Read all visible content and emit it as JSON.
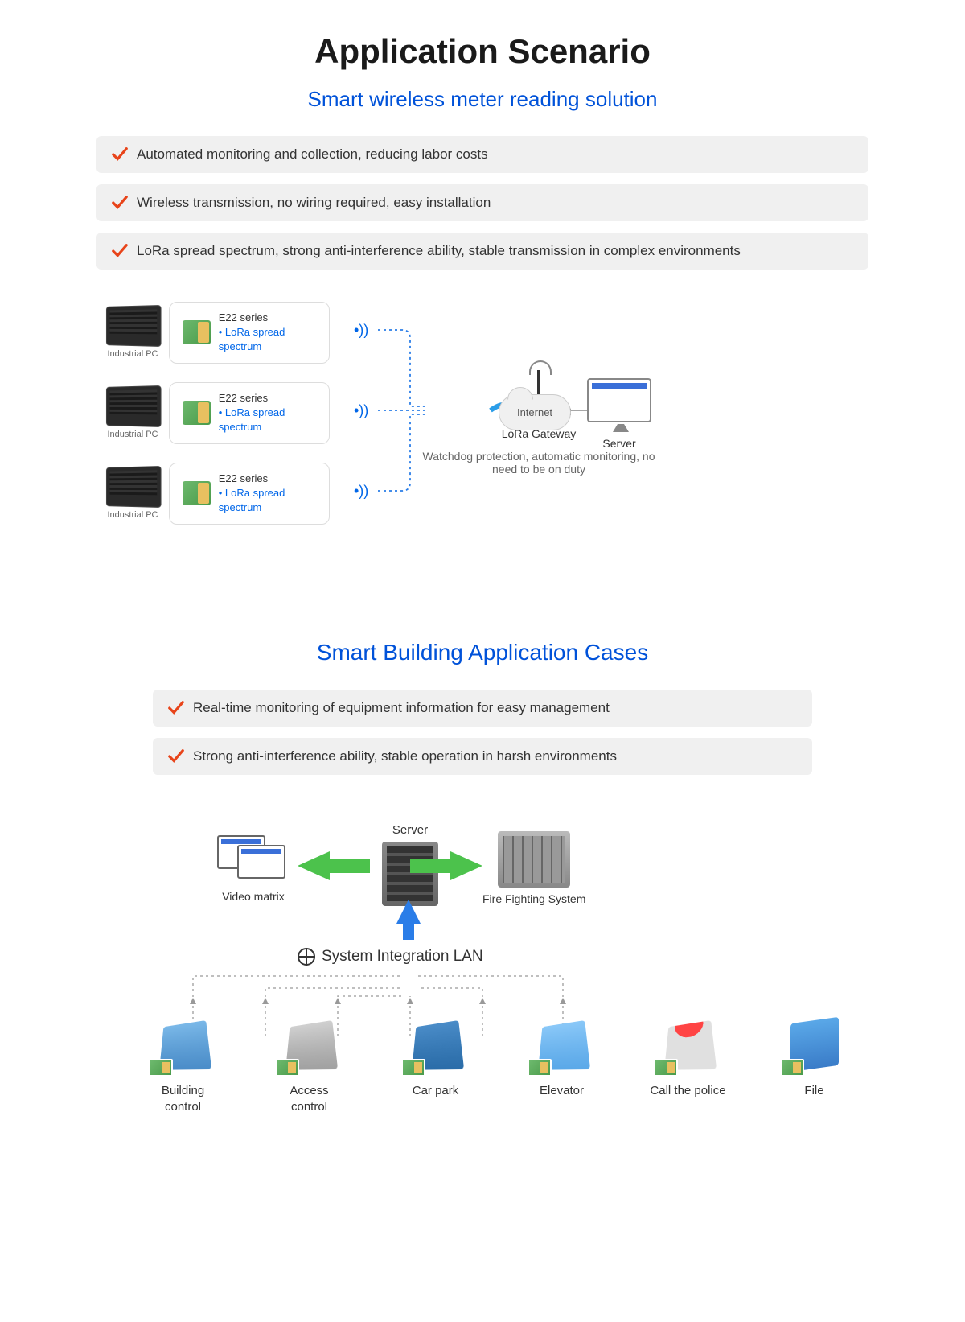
{
  "main": {
    "title": "Application Scenario",
    "subtitle1": "Smart wireless meter reading solution",
    "features1": [
      "Automated monitoring and collection, reducing labor costs",
      "Wireless transmission, no wiring required, easy installation",
      "LoRa spread spectrum, strong anti-interference ability, stable transmission in complex environments"
    ],
    "diagram1": {
      "ipc_label": "Industrial PC",
      "module_title": "E22 series",
      "module_sub": "LoRa spread spectrum",
      "gateway_label": "LoRa Gateway",
      "internet_label": "Internet",
      "server_label": "Server",
      "note": "Watchdog protection, automatic monitoring, no need to be on duty"
    },
    "subtitle2": "Smart Building Application Cases",
    "features2": [
      "Real-time monitoring of equipment information for easy management",
      "Strong anti-interference ability, stable operation in harsh environments"
    ],
    "diagram2": {
      "server_label": "Server",
      "video_matrix": "Video matrix",
      "fire_fighting": "Fire Fighting System",
      "sil": "System Integration LAN",
      "items": [
        "Building control",
        "Access control",
        "Car park",
        "Elevator",
        "Call the police",
        "File"
      ]
    }
  }
}
